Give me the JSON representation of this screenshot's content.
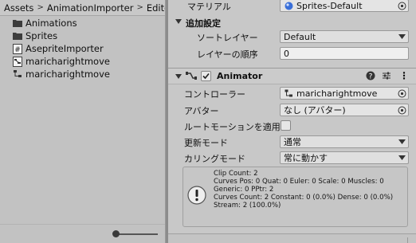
{
  "project": {
    "breadcrumb": [
      "Assets",
      "AnimationImporter",
      "Editor"
    ],
    "breadcrumb_separator": ">",
    "items": [
      {
        "label": "Animations",
        "icon": "folder-icon"
      },
      {
        "label": "Sprites",
        "icon": "folder-icon"
      },
      {
        "label": "AsepriteImporter",
        "icon": "script-icon"
      },
      {
        "label": "maricharightmove",
        "icon": "animator-controller-icon"
      },
      {
        "label": "maricharightmove",
        "icon": "animator-controller-icon"
      }
    ],
    "zoom_level": 0.0
  },
  "inspector": {
    "material": {
      "label": "マテリアル",
      "value": "Sprites-Default"
    },
    "additional_settings": {
      "title": "追加設定",
      "sorting_layer": {
        "label": "ソートレイヤー",
        "value": "Default"
      },
      "order_in_layer": {
        "label": "レイヤーの順序",
        "value": "0"
      }
    },
    "animator": {
      "title": "Animator",
      "enabled": true,
      "controller": {
        "label": "コントローラー",
        "value": "maricharightmove"
      },
      "avatar": {
        "label": "アバター",
        "value": "なし (アバター)"
      },
      "apply_root_motion": {
        "label": "ルートモーションを適用",
        "checked": false
      },
      "update_mode": {
        "label": "更新モード",
        "value": "通常"
      },
      "culling_mode": {
        "label": "カリングモード",
        "value": "常に動かす"
      },
      "info_lines": [
        "Clip Count: 2",
        "Curves Pos: 0 Quat: 0 Euler: 0 Scale: 0 Muscles: 0",
        "Generic: 0 PPtr: 2",
        "Curves Count: 2 Constant: 0 (0.0%) Dense: 0 (0.0%)",
        "Stream: 2 (100.0%)"
      ]
    }
  }
}
